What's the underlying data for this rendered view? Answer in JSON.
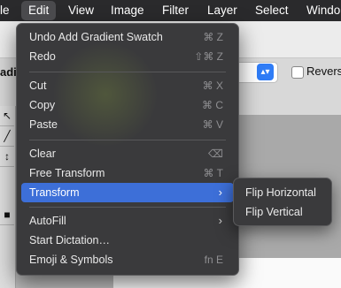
{
  "menubar": {
    "items": [
      {
        "label": "le",
        "active": false
      },
      {
        "label": "Edit",
        "active": true
      },
      {
        "label": "View",
        "active": false
      },
      {
        "label": "Image",
        "active": false
      },
      {
        "label": "Filter",
        "active": false
      },
      {
        "label": "Layer",
        "active": false
      },
      {
        "label": "Select",
        "active": false
      },
      {
        "label": "Windo",
        "active": false
      }
    ]
  },
  "background": {
    "option_label_fragment": "adie",
    "reverse_label": "Revers",
    "tool_glyphs": [
      "↖",
      "╱",
      "↕",
      "■"
    ]
  },
  "edit_menu": {
    "groups": [
      [
        {
          "label": "Undo Add Gradient Swatch",
          "shortcut": "⌘ Z"
        },
        {
          "label": "Redo",
          "shortcut": "⇧⌘ Z"
        }
      ],
      [
        {
          "label": "Cut",
          "shortcut": "⌘ X"
        },
        {
          "label": "Copy",
          "shortcut": "⌘ C"
        },
        {
          "label": "Paste",
          "shortcut": "⌘ V"
        }
      ],
      [
        {
          "label": "Clear",
          "shortcut": "⌫"
        },
        {
          "label": "Free Transform",
          "shortcut": "⌘ T"
        },
        {
          "label": "Transform",
          "shortcut": "›",
          "highlighted": true
        }
      ],
      [
        {
          "label": "AutoFill",
          "shortcut": "›"
        },
        {
          "label": "Start Dictation…",
          "shortcut": ""
        },
        {
          "label": "Emoji & Symbols",
          "shortcut": "fn E"
        }
      ]
    ]
  },
  "transform_submenu": {
    "items": [
      "Flip Horizontal",
      "Flip Vertical"
    ]
  },
  "colors": {
    "highlight": "#3d6fd8",
    "menu_bg": "#3a3a3c",
    "menubar_bg": "#2a2a2c"
  }
}
